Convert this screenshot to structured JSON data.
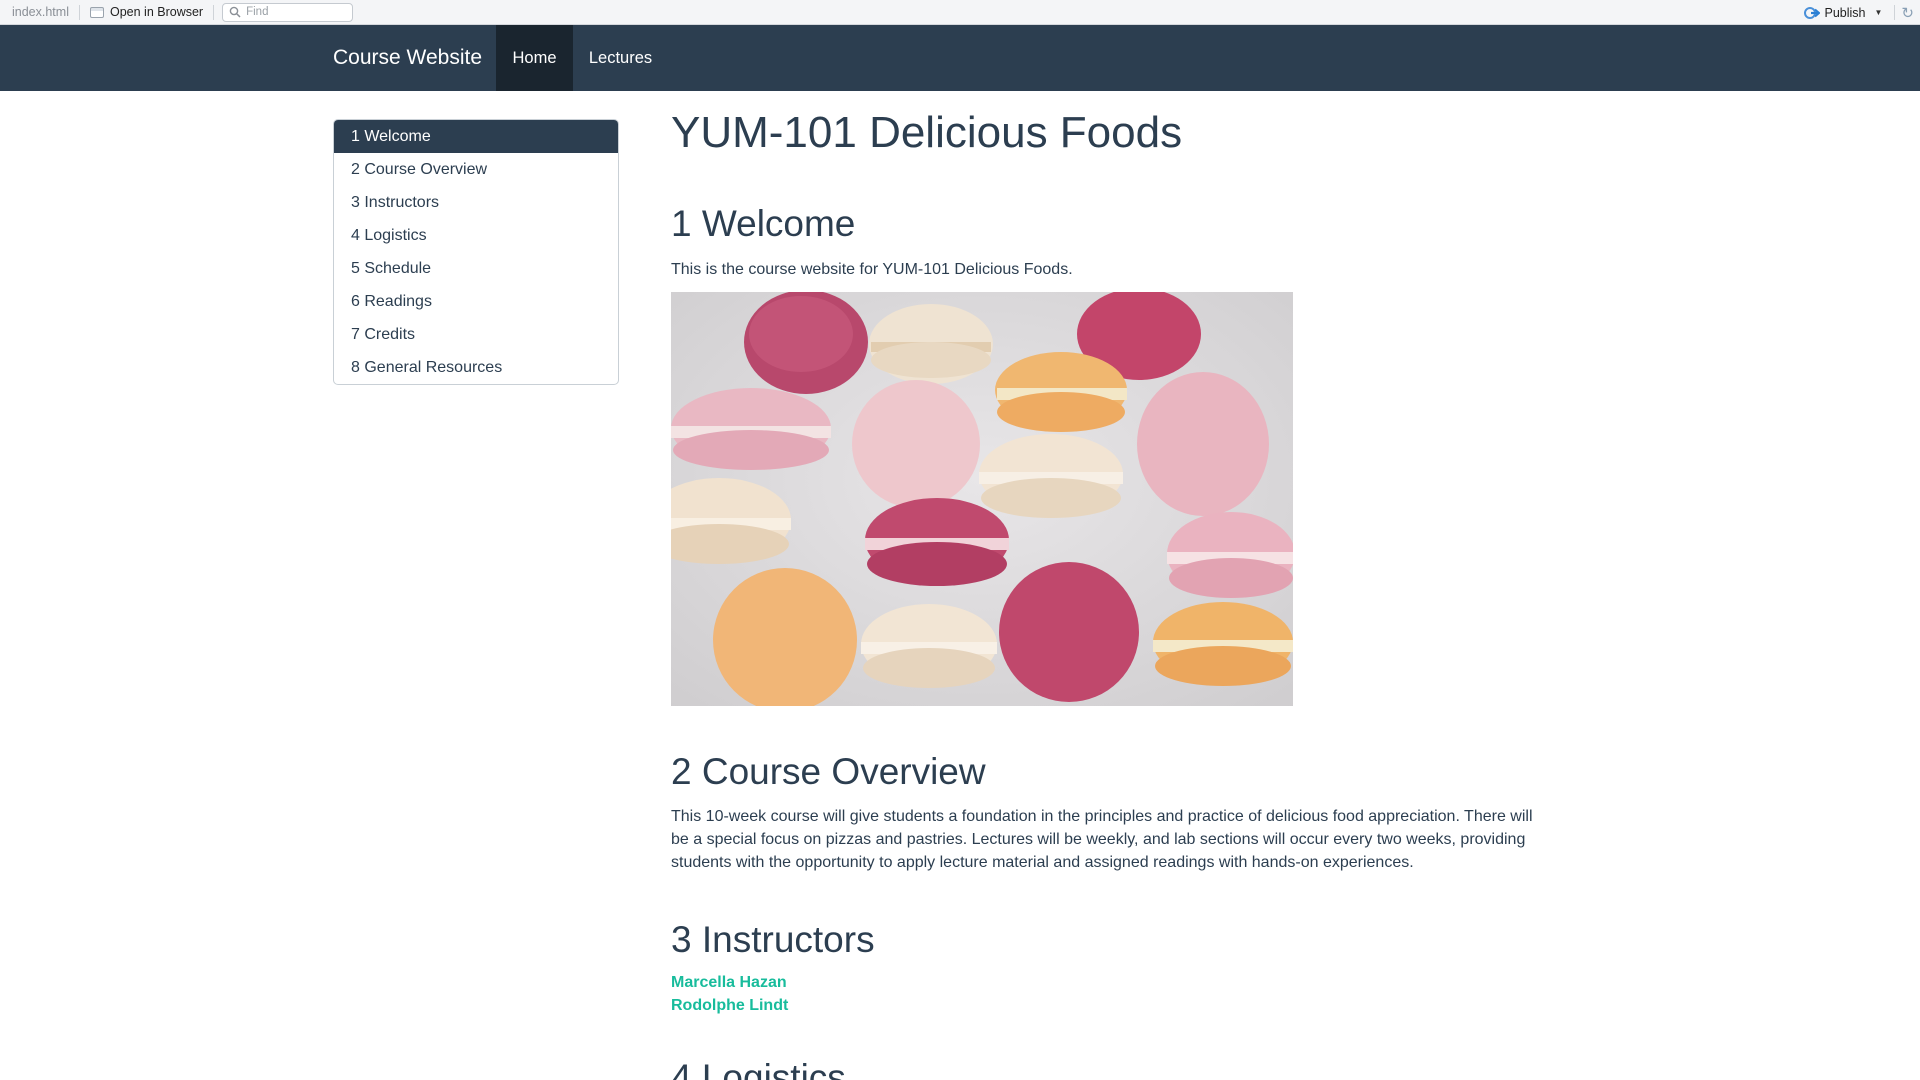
{
  "viewer": {
    "file_name": "index.html",
    "open_in_browser": "Open in Browser",
    "find_placeholder": "Find",
    "publish": "Publish",
    "icons": [
      "open-window-icon",
      "search-icon",
      "publish-icon",
      "chevron-down-icon",
      "refresh-icon"
    ]
  },
  "navbar": {
    "brand": "Course Website",
    "items": [
      {
        "label": "Home",
        "active": true
      },
      {
        "label": "Lectures",
        "active": false
      }
    ],
    "colors": {
      "background": "#2c3e50",
      "active": "#1a252f"
    }
  },
  "toc": [
    {
      "label": "1 Welcome",
      "active": true
    },
    {
      "label": "2 Course Overview",
      "active": false
    },
    {
      "label": "3 Instructors",
      "active": false
    },
    {
      "label": "4 Logistics",
      "active": false
    },
    {
      "label": "5 Schedule",
      "active": false
    },
    {
      "label": "6 Readings",
      "active": false
    },
    {
      "label": "7 Credits",
      "active": false
    },
    {
      "label": "8 General Resources",
      "active": false
    }
  ],
  "content": {
    "title": "YUM-101 Delicious Foods",
    "welcome": {
      "heading": "1 Welcome",
      "text": "This is the course website for YUM-101 Delicious Foods."
    },
    "overview": {
      "heading": "2 Course Overview",
      "text": "This 10-week course will give students a foundation in the principles and practice of delicious food appreciation. There will be a special focus on pizzas and pastries. Lectures will be weekly, and lab sections will occur every two weeks, providing students with the opportunity to apply lecture material and assigned readings with hands-on experiences."
    },
    "instructors": {
      "heading": "3 Instructors",
      "people": [
        "Marcella Hazan",
        "Rodolphe Lindt"
      ]
    },
    "logistics": {
      "heading": "4 Logistics"
    }
  },
  "colors": {
    "accent": "#18bc9c",
    "text": "#2c3e50"
  }
}
